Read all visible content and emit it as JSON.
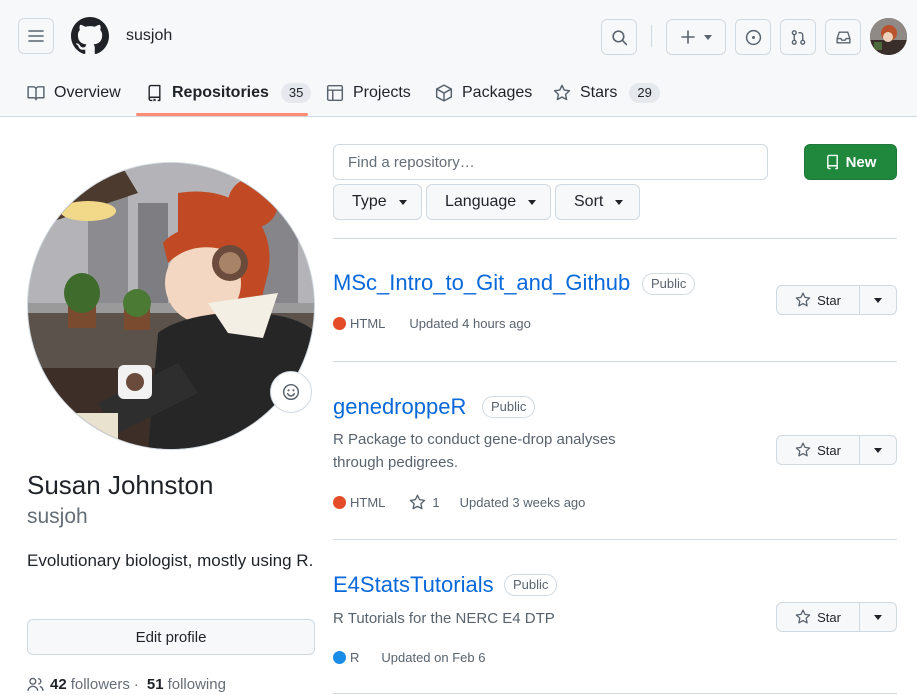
{
  "header": {
    "username": "susjoh",
    "tabs": [
      {
        "label": "Overview",
        "count": ""
      },
      {
        "label": "Repositories",
        "count": "35"
      },
      {
        "label": "Projects",
        "count": ""
      },
      {
        "label": "Packages",
        "count": ""
      },
      {
        "label": "Stars",
        "count": "29"
      }
    ]
  },
  "profile": {
    "full_name": "Susan Johnston",
    "login": "susjoh",
    "bio": "Evolutionary biologist, mostly using R.",
    "edit_label": "Edit profile",
    "followers_count": "42",
    "followers_label": "followers",
    "separator": "·",
    "following_count": "51",
    "following_label": "following"
  },
  "repo_toolbar": {
    "search_placeholder": "Find a repository…",
    "new_label": "New",
    "filters": [
      "Type",
      "Language",
      "Sort"
    ]
  },
  "repos": [
    {
      "name": "MSc_Intro_to_Git_and_Github",
      "visibility": "Public",
      "description": "",
      "language": "HTML",
      "language_color": "#e34c26",
      "stars": "",
      "updated": "Updated 4 hours ago",
      "star_label": "Star"
    },
    {
      "name": "genedroppeR",
      "visibility": "Public",
      "description": "R Package to conduct gene-drop analyses through pedigrees.",
      "language": "HTML",
      "language_color": "#e34c26",
      "stars": "1",
      "updated": "Updated 3 weeks ago",
      "star_label": "Star"
    },
    {
      "name": "E4StatsTutorials",
      "visibility": "Public",
      "description": "R Tutorials for the NERC E4 DTP",
      "language": "R",
      "language_color": "#198ce7",
      "stars": "",
      "updated": "Updated on Feb 6",
      "star_label": "Star"
    }
  ]
}
